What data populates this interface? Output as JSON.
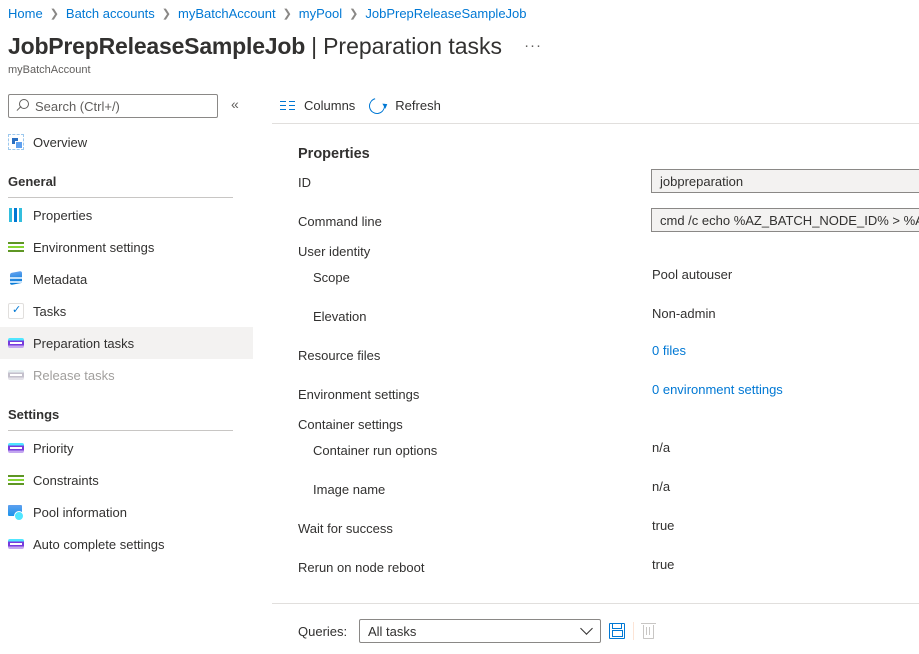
{
  "breadcrumb": [
    {
      "label": "Home"
    },
    {
      "label": "Batch accounts"
    },
    {
      "label": "myBatchAccount"
    },
    {
      "label": "myPool"
    },
    {
      "label": "JobPrepReleaseSampleJob"
    }
  ],
  "header": {
    "title": "JobPrepReleaseSampleJob",
    "separator": "|",
    "page": "Preparation tasks",
    "more": "···",
    "subtitle": "myBatchAccount"
  },
  "sidebar": {
    "search_placeholder": "Search (Ctrl+/)",
    "collapse": "«",
    "overview": {
      "label": "Overview",
      "icon": "overview-icon"
    },
    "sections": [
      {
        "title": "General",
        "items": [
          {
            "label": "Properties",
            "icon": "properties-icon"
          },
          {
            "label": "Environment settings",
            "icon": "environment-settings-icon"
          },
          {
            "label": "Metadata",
            "icon": "metadata-icon"
          },
          {
            "label": "Tasks",
            "icon": "tasks-icon"
          },
          {
            "label": "Preparation tasks",
            "icon": "preparation-tasks-icon",
            "selected": true
          },
          {
            "label": "Release tasks",
            "icon": "release-tasks-icon",
            "disabled": true
          }
        ]
      },
      {
        "title": "Settings",
        "items": [
          {
            "label": "Priority",
            "icon": "priority-icon"
          },
          {
            "label": "Constraints",
            "icon": "constraints-icon"
          },
          {
            "label": "Pool information",
            "icon": "pool-information-icon"
          },
          {
            "label": "Auto complete settings",
            "icon": "auto-complete-settings-icon"
          }
        ]
      }
    ]
  },
  "toolbar": {
    "columns_label": "Columns",
    "refresh_label": "Refresh"
  },
  "properties": {
    "title": "Properties",
    "id_label": "ID",
    "id_value": "jobpreparation",
    "command_line_label": "Command line",
    "command_line_value": "cmd /c echo %AZ_BATCH_NODE_ID% > %AZ_BATCH_NODE_SHARED_DIR%",
    "user_identity_label": "User identity",
    "scope_label": "Scope",
    "scope_value": "Pool autouser",
    "elevation_label": "Elevation",
    "elevation_value": "Non-admin",
    "resource_files_label": "Resource files",
    "resource_files_value": "0 files",
    "environment_settings_label": "Environment settings",
    "environment_settings_value": "0 environment settings",
    "container_settings_label": "Container settings",
    "container_run_options_label": "Container run options",
    "container_run_options_value": "n/a",
    "image_name_label": "Image name",
    "image_name_value": "n/a",
    "wait_for_success_label": "Wait for success",
    "wait_for_success_value": "true",
    "rerun_on_node_reboot_label": "Rerun on node reboot",
    "rerun_on_node_reboot_value": "true"
  },
  "queries": {
    "label": "Queries:",
    "selected": "All tasks"
  },
  "colors": {
    "link": "#0078d4",
    "text": "#323130",
    "selected_bg": "#f3f2f1",
    "disabled_text": "#a19f9d"
  }
}
